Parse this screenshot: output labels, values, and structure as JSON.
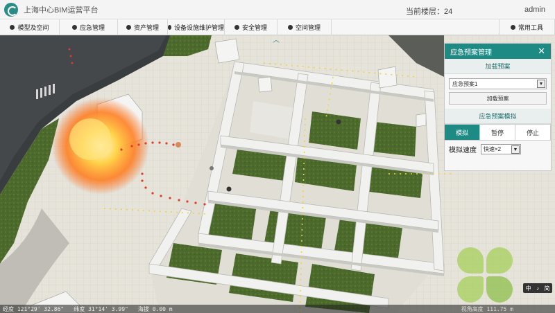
{
  "app": {
    "title": "上海中心BIM运营平台"
  },
  "header": {
    "floor_label": "当前楼层：24",
    "user": "admin"
  },
  "menu": {
    "items": [
      {
        "label": "模型及空间",
        "icon": "layers-icon"
      },
      {
        "label": "应急管理",
        "icon": "alert-icon"
      },
      {
        "label": "资产管理",
        "icon": "box-icon"
      },
      {
        "label": "设备设施维护管理",
        "icon": "wrench-icon"
      },
      {
        "label": "安全管理",
        "icon": "shield-icon"
      },
      {
        "label": "空间管理",
        "icon": "grid-icon"
      }
    ],
    "tools_label": "常用工具"
  },
  "panel": {
    "title": "应急预案管理",
    "close_label": "✕",
    "load_section_title": "加载预案",
    "plan_select_value": "应急预案1",
    "load_button": "加载预案",
    "sim_section_title": "应急预案模拟",
    "sim_tabs": [
      "模拟",
      "暂停",
      "停止"
    ],
    "speed_label": "模拟速度",
    "speed_value": "快速×2"
  },
  "status": {
    "longitude": "经度 121°29' 32.86\"",
    "latitude": "纬度 31°14' 3.99\"",
    "altitude": "海拔 0.00 m",
    "eye": "视角高度 111.75 m"
  },
  "mini_toolbar": {
    "a": "中",
    "b": "♪",
    "c": "简"
  },
  "colors": {
    "accent": "#1e8a84",
    "fire": "#ff8a1c"
  }
}
